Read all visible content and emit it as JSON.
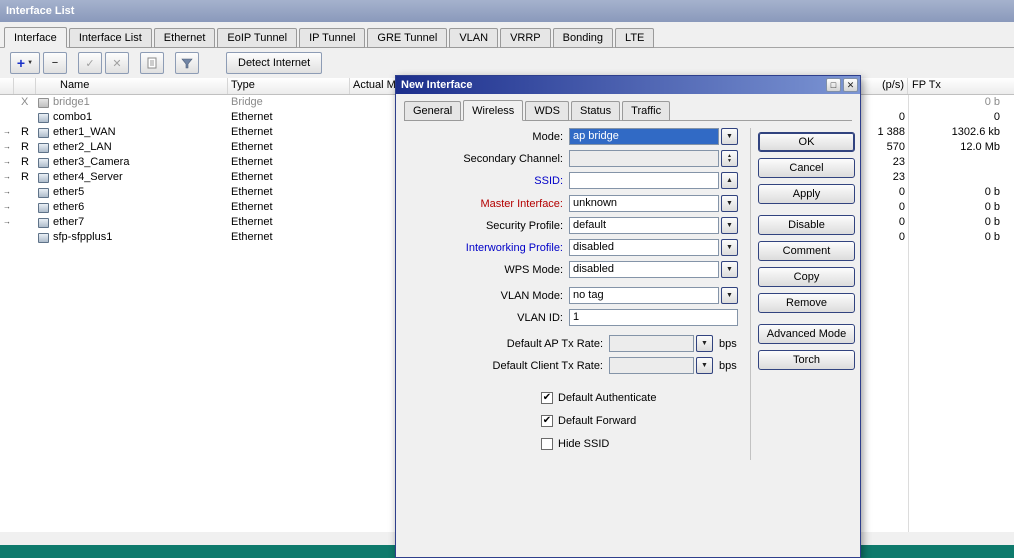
{
  "window": {
    "title": "Interface List"
  },
  "tabs": [
    {
      "label": "Interface"
    },
    {
      "label": "Interface List"
    },
    {
      "label": "Ethernet"
    },
    {
      "label": "EoIP Tunnel"
    },
    {
      "label": "IP Tunnel"
    },
    {
      "label": "GRE Tunnel"
    },
    {
      "label": "VLAN"
    },
    {
      "label": "VRRP"
    },
    {
      "label": "Bonding"
    },
    {
      "label": "LTE"
    }
  ],
  "toolbar": {
    "detect_internet": "Detect Internet"
  },
  "icons": {
    "add": "+",
    "caret": "▼",
    "remove": "−",
    "enable": "✓",
    "disable": "✕",
    "drop": "▼",
    "up": "▲",
    "spin_up": "▲",
    "spin_down": "▼",
    "restore": "□",
    "close": "✕",
    "check": "✔"
  },
  "colors": {
    "selection": "#316ac5",
    "label_red": "#b40000",
    "label_blue": "#0000c8",
    "titlebar_active": "#1c2e8c",
    "desktop": "#0e7a6c"
  },
  "table": {
    "columns": {
      "name": "Name",
      "type": "Type",
      "actual": "Actual M",
      "ps": "(p/s)",
      "fp_tx": "FP Tx"
    },
    "rows": [
      {
        "arrow": "",
        "flag": "X",
        "name": "bridge1",
        "type": "Bridge",
        "ps": "",
        "fptx": "0 b"
      },
      {
        "arrow": "",
        "flag": "",
        "name": "combo1",
        "type": "Ethernet",
        "ps": "0",
        "fptx": "0"
      },
      {
        "arrow": "→",
        "flag": "R",
        "name": "ether1_WAN",
        "type": "Ethernet",
        "ps": "1 388",
        "fptx": "1302.6 kb"
      },
      {
        "arrow": "→",
        "flag": "R",
        "name": "ether2_LAN",
        "type": "Ethernet",
        "ps": "570",
        "fptx": "12.0 Mb"
      },
      {
        "arrow": "→",
        "flag": "R",
        "name": "ether3_Camera",
        "type": "Ethernet",
        "ps": "23",
        "fptx": ""
      },
      {
        "arrow": "→",
        "flag": "R",
        "name": "ether4_Server",
        "type": "Ethernet",
        "ps": "23",
        "fptx": ""
      },
      {
        "arrow": "→",
        "flag": "",
        "name": "ether5",
        "type": "Ethernet",
        "ps": "0",
        "fptx": "0 b"
      },
      {
        "arrow": "→",
        "flag": "",
        "name": "ether6",
        "type": "Ethernet",
        "ps": "0",
        "fptx": "0 b"
      },
      {
        "arrow": "→",
        "flag": "",
        "name": "ether7",
        "type": "Ethernet",
        "ps": "0",
        "fptx": "0 b"
      },
      {
        "arrow": "",
        "flag": "",
        "name": "sfp-sfpplus1",
        "type": "Ethernet",
        "ps": "0",
        "fptx": "0 b"
      }
    ]
  },
  "dialog": {
    "title": "New Interface",
    "tabs": [
      {
        "label": "General"
      },
      {
        "label": "Wireless"
      },
      {
        "label": "WDS"
      },
      {
        "label": "Status"
      },
      {
        "label": "Traffic"
      }
    ],
    "fields": {
      "mode": {
        "label": "Mode:",
        "value": "ap bridge"
      },
      "secondary_channel": {
        "label": "Secondary Channel:",
        "value": ""
      },
      "ssid": {
        "label": "SSID:",
        "value": ""
      },
      "master_interface": {
        "label": "Master Interface:",
        "value": "unknown"
      },
      "security_profile": {
        "label": "Security Profile:",
        "value": "default"
      },
      "interworking_profile": {
        "label": "Interworking Profile:",
        "value": "disabled"
      },
      "wps_mode": {
        "label": "WPS Mode:",
        "value": "disabled"
      },
      "vlan_mode": {
        "label": "VLAN Mode:",
        "value": "no tag"
      },
      "vlan_id": {
        "label": "VLAN ID:",
        "value": "1"
      },
      "default_ap_tx_rate": {
        "label": "Default AP Tx Rate:",
        "value": "",
        "unit": "bps"
      },
      "default_client_tx_rate": {
        "label": "Default Client Tx Rate:",
        "value": "",
        "unit": "bps"
      }
    },
    "checkboxes": [
      {
        "label": "Default Authenticate",
        "mark": "✔"
      },
      {
        "label": "Default Forward",
        "mark": "✔"
      },
      {
        "label": "Hide SSID",
        "mark": ""
      }
    ],
    "buttons": {
      "ok": "OK",
      "cancel": "Cancel",
      "apply": "Apply",
      "disable": "Disable",
      "comment": "Comment",
      "copy": "Copy",
      "remove": "Remove",
      "advanced_mode": "Advanced Mode",
      "torch": "Torch"
    }
  }
}
